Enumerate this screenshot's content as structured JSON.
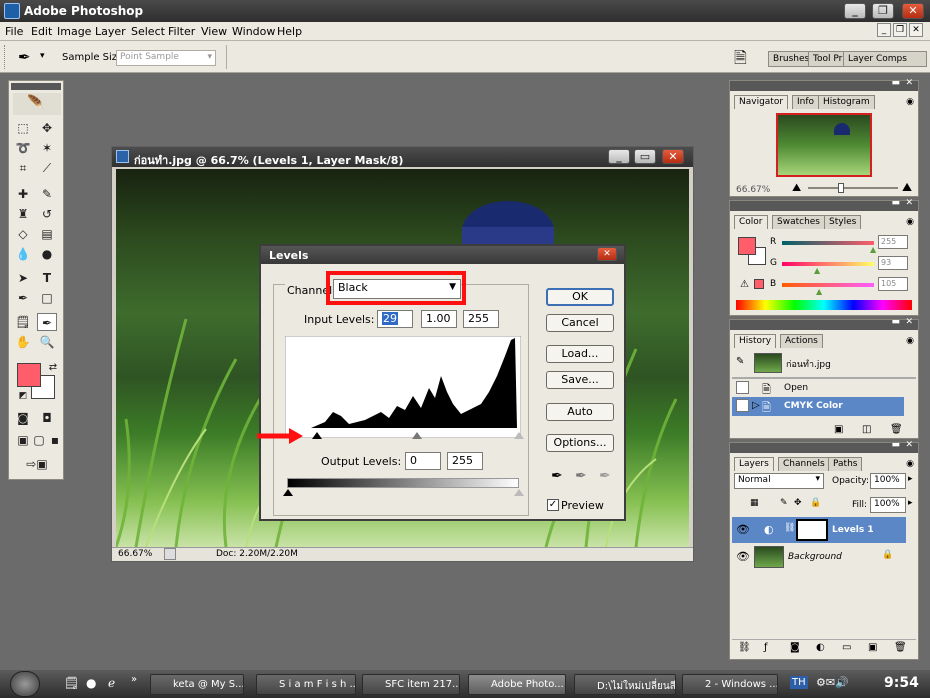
{
  "app": {
    "title": "Adobe Photoshop",
    "menu": [
      "File",
      "Edit",
      "Image",
      "Layer",
      "Select",
      "Filter",
      "View",
      "Window",
      "Help"
    ]
  },
  "options_bar": {
    "sample_size_label": "Sample Size:",
    "sample_size_value": "Point Sample",
    "palette_well_tabs": [
      "Brushes",
      "Tool Pr",
      "Layer Comps"
    ]
  },
  "document": {
    "title": "ก่อนทำ.jpg @ 66.7% (Levels 1, Layer Mask/8)",
    "zoom": "66.67%",
    "doc_info": "Doc: 2.20M/2.20M"
  },
  "levels_dialog": {
    "title": "Levels",
    "channel_label": "Channel:",
    "channel_value": "Black",
    "input_levels_label": "Input Levels:",
    "input_levels": [
      "29",
      "1.00",
      "255"
    ],
    "output_levels_label": "Output Levels:",
    "output_levels": [
      "0",
      "255"
    ],
    "buttons": [
      "OK",
      "Cancel",
      "Load...",
      "Save...",
      "Auto",
      "Options..."
    ],
    "preview_label": "Preview",
    "preview_checked": true
  },
  "navigator_panel": {
    "tabs": [
      "Navigator",
      "Info",
      "Histogram"
    ],
    "zoom": "66.67%"
  },
  "color_panel": {
    "tabs": [
      "Color",
      "Swatches",
      "Styles"
    ],
    "channels": [
      {
        "label": "R",
        "value": "255"
      },
      {
        "label": "G",
        "value": "93"
      },
      {
        "label": "B",
        "value": "105"
      }
    ],
    "foreground_color": "#ff5d69"
  },
  "history_panel": {
    "tabs": [
      "History",
      "Actions"
    ],
    "snapshot_name": "ก่อนทำ.jpg",
    "states": [
      "Open",
      "CMYK Color"
    ]
  },
  "layers_panel": {
    "tabs": [
      "Layers",
      "Channels",
      "Paths"
    ],
    "blend_mode": "Normal",
    "opacity_label": "Opacity:",
    "opacity_value": "100%",
    "fill_label": "Fill:",
    "fill_value": "100%",
    "layers": [
      "Levels 1",
      "Background"
    ]
  },
  "taskbar": {
    "items": [
      "keta @ My S...",
      "S i a m F i s h ...",
      "SFC item 217...",
      "Adobe Photo...",
      "D:\\ไม่ใหม่เปลี่ยนสี",
      "2 - Windows ..."
    ],
    "clock": "9:54"
  }
}
